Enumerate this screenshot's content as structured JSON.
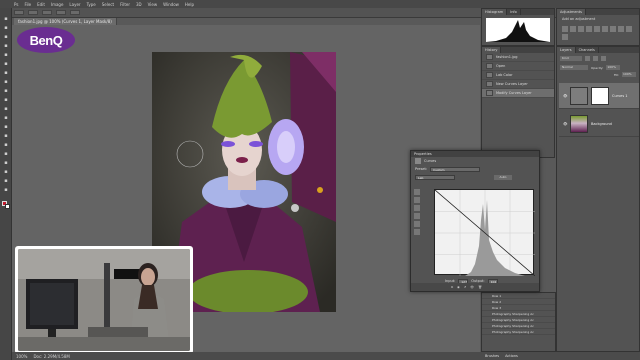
{
  "app": {
    "document_tab": "fashion1.jpg @ 100% (Curves 1, Layer Mask/8)"
  },
  "menu": [
    "Ps",
    "File",
    "Edit",
    "Image",
    "Layer",
    "Type",
    "Select",
    "Filter",
    "3D",
    "View",
    "Window",
    "Help"
  ],
  "logo": {
    "text": "BenQ",
    "color": "#6a2d91"
  },
  "status": {
    "zoom": "100%",
    "doc": "Doc: 2.29M/4.58M"
  },
  "histogram": {
    "tabs": [
      "Histogram",
      "Info"
    ]
  },
  "history": {
    "tabs": [
      "History"
    ],
    "items": [
      "fashion1.jpg",
      "Open",
      "Lab Color",
      "New Curves Layer",
      "Modify Curves Layer"
    ],
    "selected_index": 4
  },
  "adjustments": {
    "tabs": [
      "Adjustments"
    ],
    "subtitle": "Add an adjustment"
  },
  "layers": {
    "tabs": [
      "Layers",
      "Channels"
    ],
    "kind": "Kind",
    "blend": "Normal",
    "opacity_label": "Opacity:",
    "opacity": "100%",
    "fill_label": "Fill:",
    "fill": "100%",
    "rows": [
      {
        "name": "Curves 1",
        "selected": true
      },
      {
        "name": "Background",
        "selected": false
      }
    ]
  },
  "properties": {
    "title": "Properties",
    "panel_name": "Curves",
    "preset_label": "Preset:",
    "preset": "Custom",
    "channel": "Lab",
    "auto": "Auto",
    "input_label": "Input:",
    "input_value": "127",
    "output_label": "Output:",
    "output_value": "102"
  },
  "lower_panel": {
    "rows": [
      "Row 1",
      "Row 2",
      "Row 3",
      "Photography Sharpening Ac",
      "Photography Sharpening Ac",
      "Photography Sharpening Ac",
      "Photography Sharpening Ac"
    ]
  },
  "bottom_tabs": [
    "Brushes",
    "Actions"
  ]
}
